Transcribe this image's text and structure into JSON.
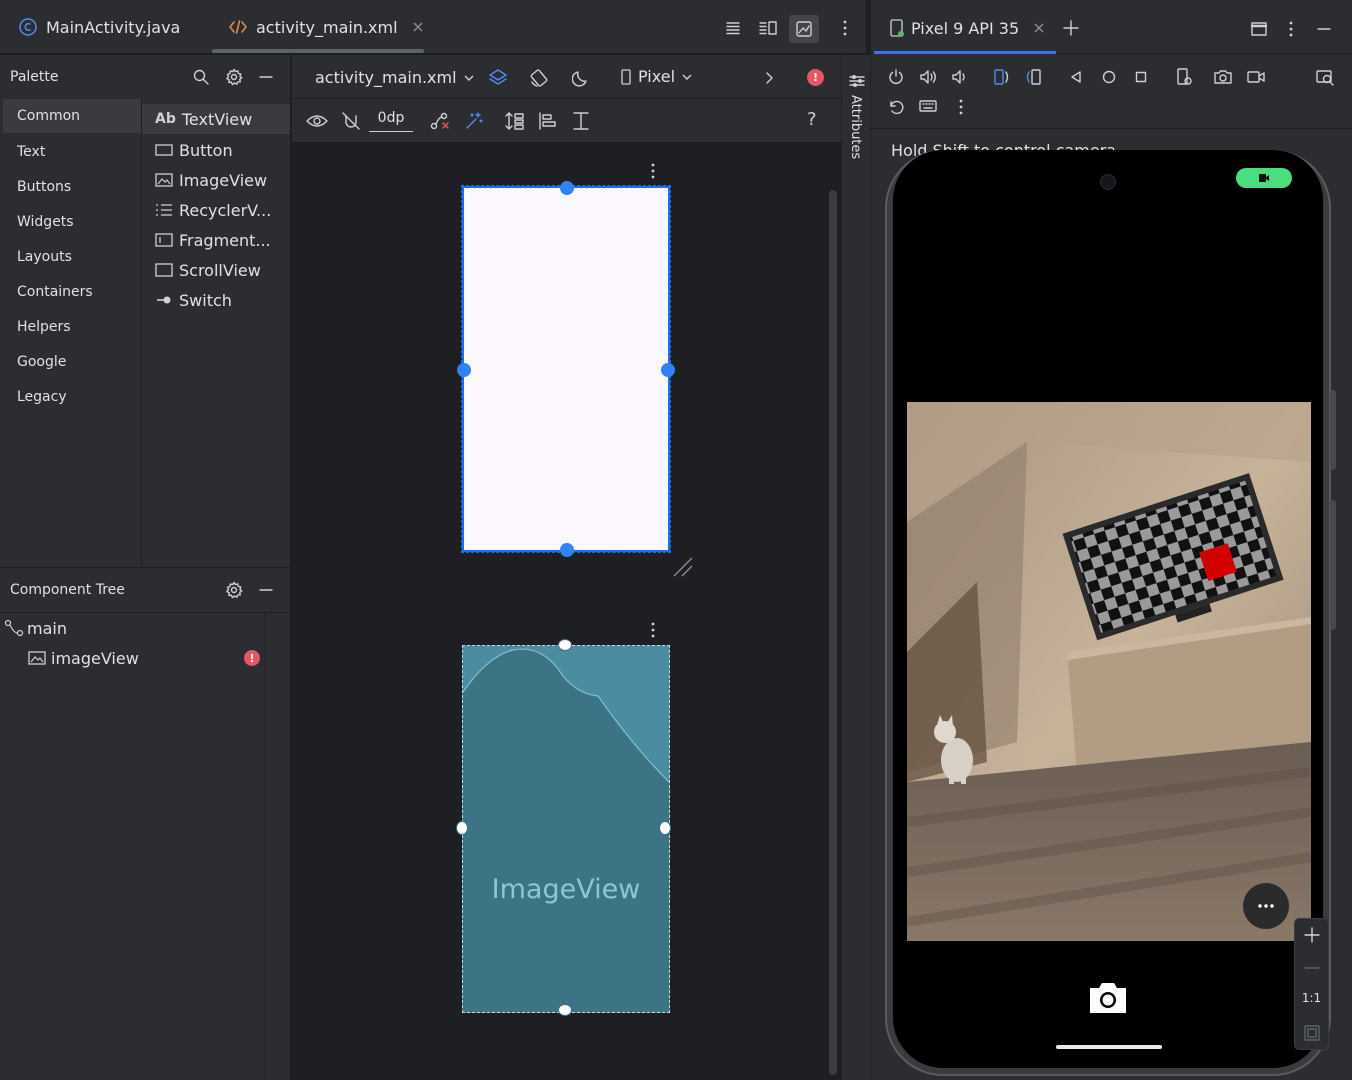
{
  "editor_tabs": [
    {
      "label": "MainActivity.java",
      "icon": "java-class-icon"
    },
    {
      "label": "activity_main.xml",
      "icon": "xml-file-icon",
      "active": true
    }
  ],
  "palette": {
    "title": "Palette",
    "categories": [
      "Common",
      "Text",
      "Buttons",
      "Widgets",
      "Layouts",
      "Containers",
      "Helpers",
      "Google",
      "Legacy"
    ],
    "widgets": [
      {
        "label": "TextView",
        "icon_text": "Ab"
      },
      {
        "label": "Button"
      },
      {
        "label": "ImageView"
      },
      {
        "label": "RecyclerV..."
      },
      {
        "label": "Fragment..."
      },
      {
        "label": "ScrollView"
      },
      {
        "label": "Switch"
      }
    ]
  },
  "component_tree": {
    "title": "Component Tree",
    "items": [
      {
        "label": "main"
      },
      {
        "label": "imageView"
      }
    ]
  },
  "design_toolbar": {
    "file": "activity_main.xml",
    "device": "Pixel",
    "margin": "0dp"
  },
  "design": {
    "blueprint_label": "ImageView",
    "help": "?"
  },
  "attributes_label": "Attributes",
  "emulator": {
    "device_tab": "Pixel 9 API 35",
    "hint": "Hold Shift to control camera",
    "zoom_ratio": "1:1"
  },
  "colors": {
    "accent": "#3574f0",
    "error": "#e55765",
    "blueprint": "#3d7485",
    "camera_pill": "#4ade80"
  }
}
